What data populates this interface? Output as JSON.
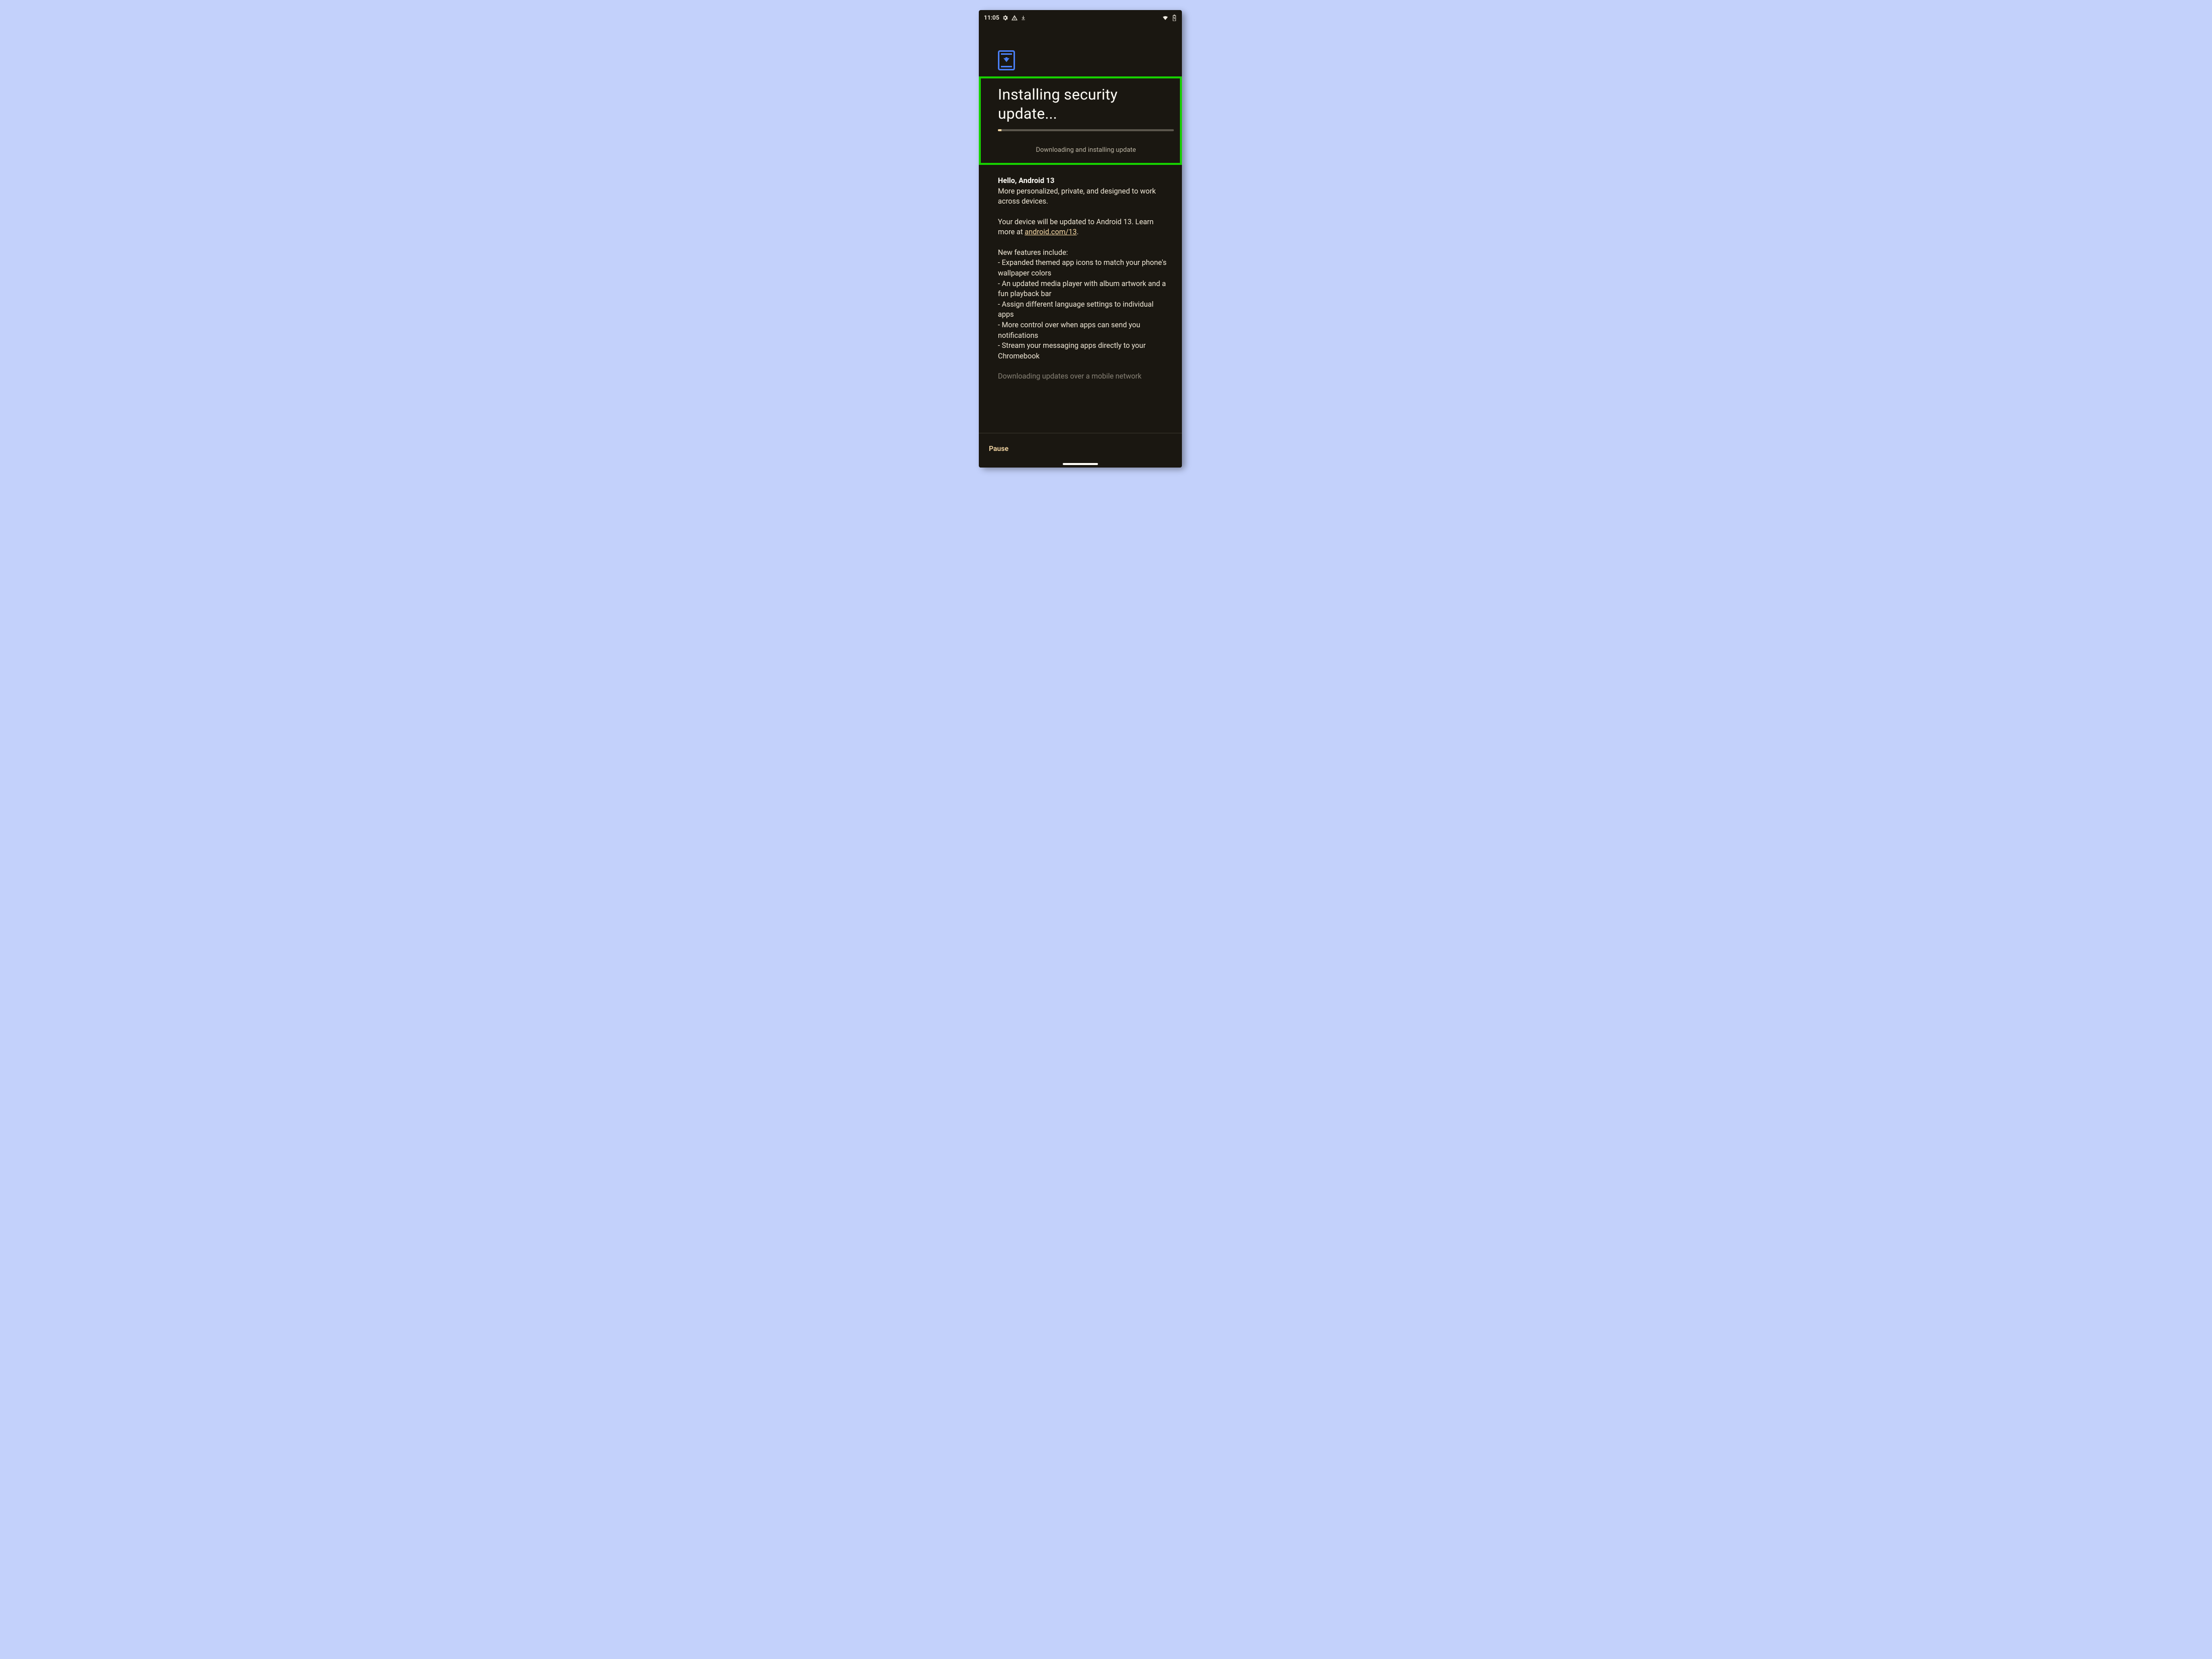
{
  "statusbar": {
    "time": "11:05",
    "icons_left": [
      "gear-icon",
      "warning-icon",
      "download-icon"
    ],
    "icons_right": [
      "wifi-icon",
      "battery-charging-icon"
    ]
  },
  "header": {
    "icon": "phone-download-icon",
    "title": "Installing security update...",
    "progress_percent": 2,
    "status_text": "Downloading and installing update"
  },
  "body": {
    "headline": "Hello, Android 13",
    "intro": "More personalized, private, and designed to work across devices.",
    "update_line_prefix": "Your device will be updated to Android 13. Learn more at ",
    "update_link_text": "android.com/13",
    "update_line_suffix": ".",
    "features_heading": "New features include:",
    "features": [
      "- Expanded themed app icons to match your phone's wallpaper colors",
      "- An updated media player with album artwork and a fun playback bar",
      "- Assign different language settings to individual apps",
      "- More control over when apps can send you notifications",
      "- Stream your messaging apps directly to your Chromebook"
    ],
    "truncated_line": "Downloading updates over a mobile network"
  },
  "bottom_bar": {
    "pause_label": "Pause"
  },
  "colors": {
    "background_page": "#c3d1fb",
    "phone_bg": "#1a1711",
    "accent": "#f6d8a5",
    "highlight_border": "#17d000",
    "icon_blue": "#4a7ef3"
  }
}
